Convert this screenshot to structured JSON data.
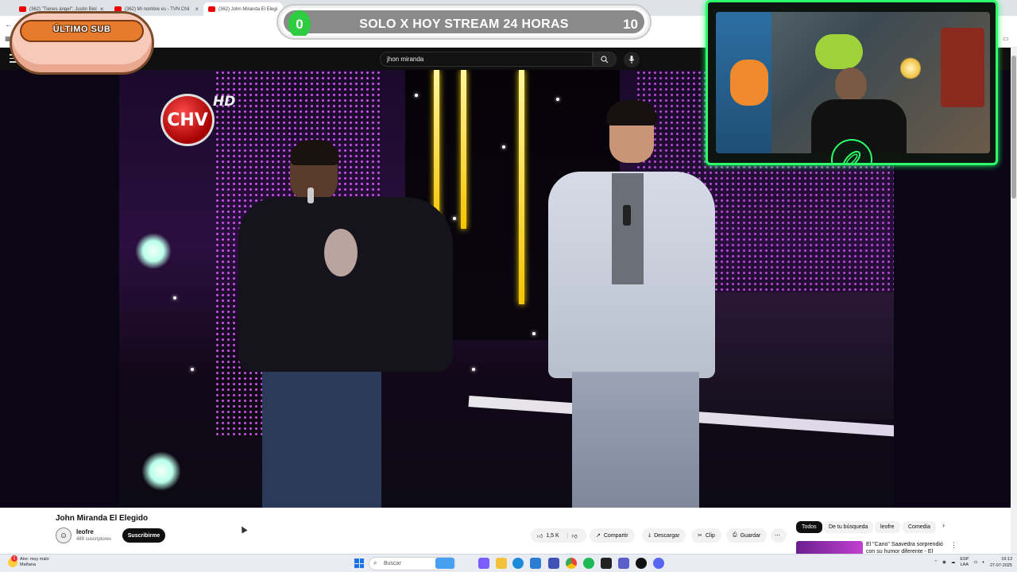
{
  "browser": {
    "tabs": [
      {
        "label": "(362) \"Tienes ángel\": Justin Biel"
      },
      {
        "label": "(362) Mi nombre es - TVN Chil"
      },
      {
        "label": "(362) John Miranda El Elegi"
      }
    ]
  },
  "youtube": {
    "search": {
      "value": "jhon miranda"
    },
    "video": {
      "title": "John Miranda El Elegido",
      "channel": "leofre",
      "subscribers": "489 suscriptores",
      "subscribe_label": "Suscribirme",
      "likes": "1,5 K",
      "share_label": "Compartir",
      "download_label": "Descargar",
      "clip_label": "Clip",
      "save_label": "Guardar",
      "player_overlay": {
        "logo": "CHV",
        "hd": "HD"
      }
    },
    "filters": [
      "Todos",
      "De tu búsqueda",
      "leofre",
      "Comedia"
    ],
    "recommendation": {
      "title": "El \"Cano\" Saavedra sorprendió con su humor diferente - El"
    }
  },
  "stream_overlay": {
    "goal": {
      "current": "0",
      "title": "SOLO X HOY STREAM 24 HORAS",
      "target": "10",
      "progress": 0.0
    },
    "last_sub_label": "ÚLTIMO SUB"
  },
  "taskbar": {
    "weather_line1": "Aire: muy malo",
    "weather_line2": "Mañana",
    "weather_badge": "1",
    "search_placeholder": "Buscar",
    "lang_line1": "ESP",
    "lang_line2": "LAA",
    "time": "19:13",
    "date": "27-07-2025"
  },
  "colors": {
    "accent_green": "#2ecc40",
    "youtube_dark": "#0f0f0f",
    "webcam_border": "#2cff6a"
  }
}
